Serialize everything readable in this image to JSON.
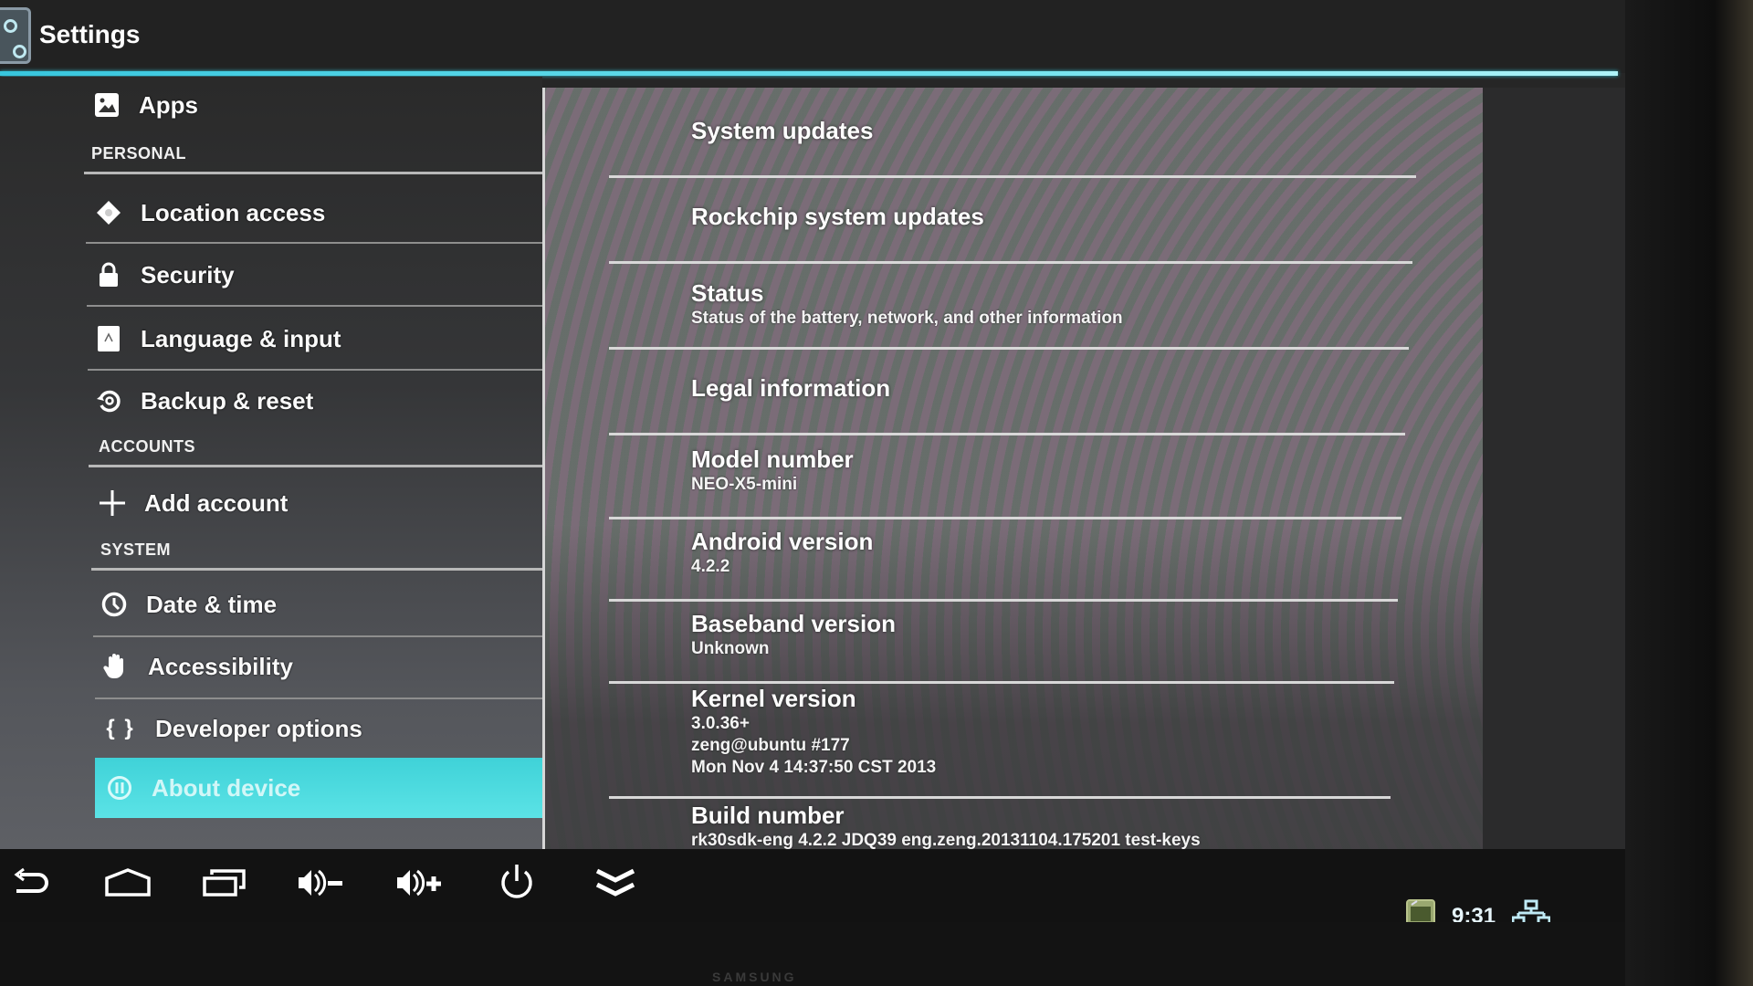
{
  "app": {
    "title": "Settings"
  },
  "sidebar": {
    "top_item": {
      "label": "Apps",
      "icon": "apps-icon"
    },
    "sections": [
      {
        "header": "PERSONAL",
        "items": [
          {
            "label": "Location access",
            "icon": "location-icon"
          },
          {
            "label": "Security",
            "icon": "lock-icon"
          },
          {
            "label": "Language & input",
            "icon": "keyboard-icon"
          },
          {
            "label": "Backup & reset",
            "icon": "backup-icon"
          }
        ]
      },
      {
        "header": "ACCOUNTS",
        "items": [
          {
            "label": "Add account",
            "icon": "plus-icon"
          }
        ]
      },
      {
        "header": "SYSTEM",
        "items": [
          {
            "label": "Date & time",
            "icon": "clock-icon"
          },
          {
            "label": "Accessibility",
            "icon": "hand-icon"
          },
          {
            "label": "Developer options",
            "icon": "braces-icon"
          },
          {
            "label": "About device",
            "icon": "info-icon",
            "selected": true
          }
        ]
      }
    ]
  },
  "about": {
    "items": [
      {
        "title": "System updates"
      },
      {
        "title": "Rockchip system updates"
      },
      {
        "title": "Status",
        "summary": "Status of the battery, network, and other information"
      },
      {
        "title": "Legal information"
      },
      {
        "title": "Model number",
        "summary": "NEO-X5-mini"
      },
      {
        "title": "Android version",
        "summary": "4.2.2"
      },
      {
        "title": "Baseband version",
        "summary": "Unknown"
      },
      {
        "title": "Kernel version",
        "summary_lines": [
          "3.0.36+",
          "zeng@ubuntu #177",
          "Mon Nov 4 14:37:50 CST 2013"
        ]
      },
      {
        "title": "Build number",
        "summary": "rk30sdk-eng 4.2.2 JDQ39 eng.zeng.20131104.175201 test-keys"
      }
    ]
  },
  "navbar": {
    "buttons": [
      {
        "name": "back",
        "icon": "back-icon"
      },
      {
        "name": "home",
        "icon": "home-icon"
      },
      {
        "name": "recent-apps",
        "icon": "recent-apps-icon"
      },
      {
        "name": "volume-down",
        "icon": "volume-down-icon"
      },
      {
        "name": "volume-up",
        "icon": "volume-up-icon"
      },
      {
        "name": "power",
        "icon": "power-icon"
      },
      {
        "name": "hide-bar",
        "icon": "double-chevron-down-icon"
      }
    ]
  },
  "status_bar": {
    "notification_icon": "screenshot-icon",
    "time": "9:31",
    "network_icon": "ethernet-icon"
  },
  "bezel": {
    "brand": "SAMSUNG"
  },
  "colors": {
    "accent": "#3fd2d8",
    "background": "#262626"
  }
}
